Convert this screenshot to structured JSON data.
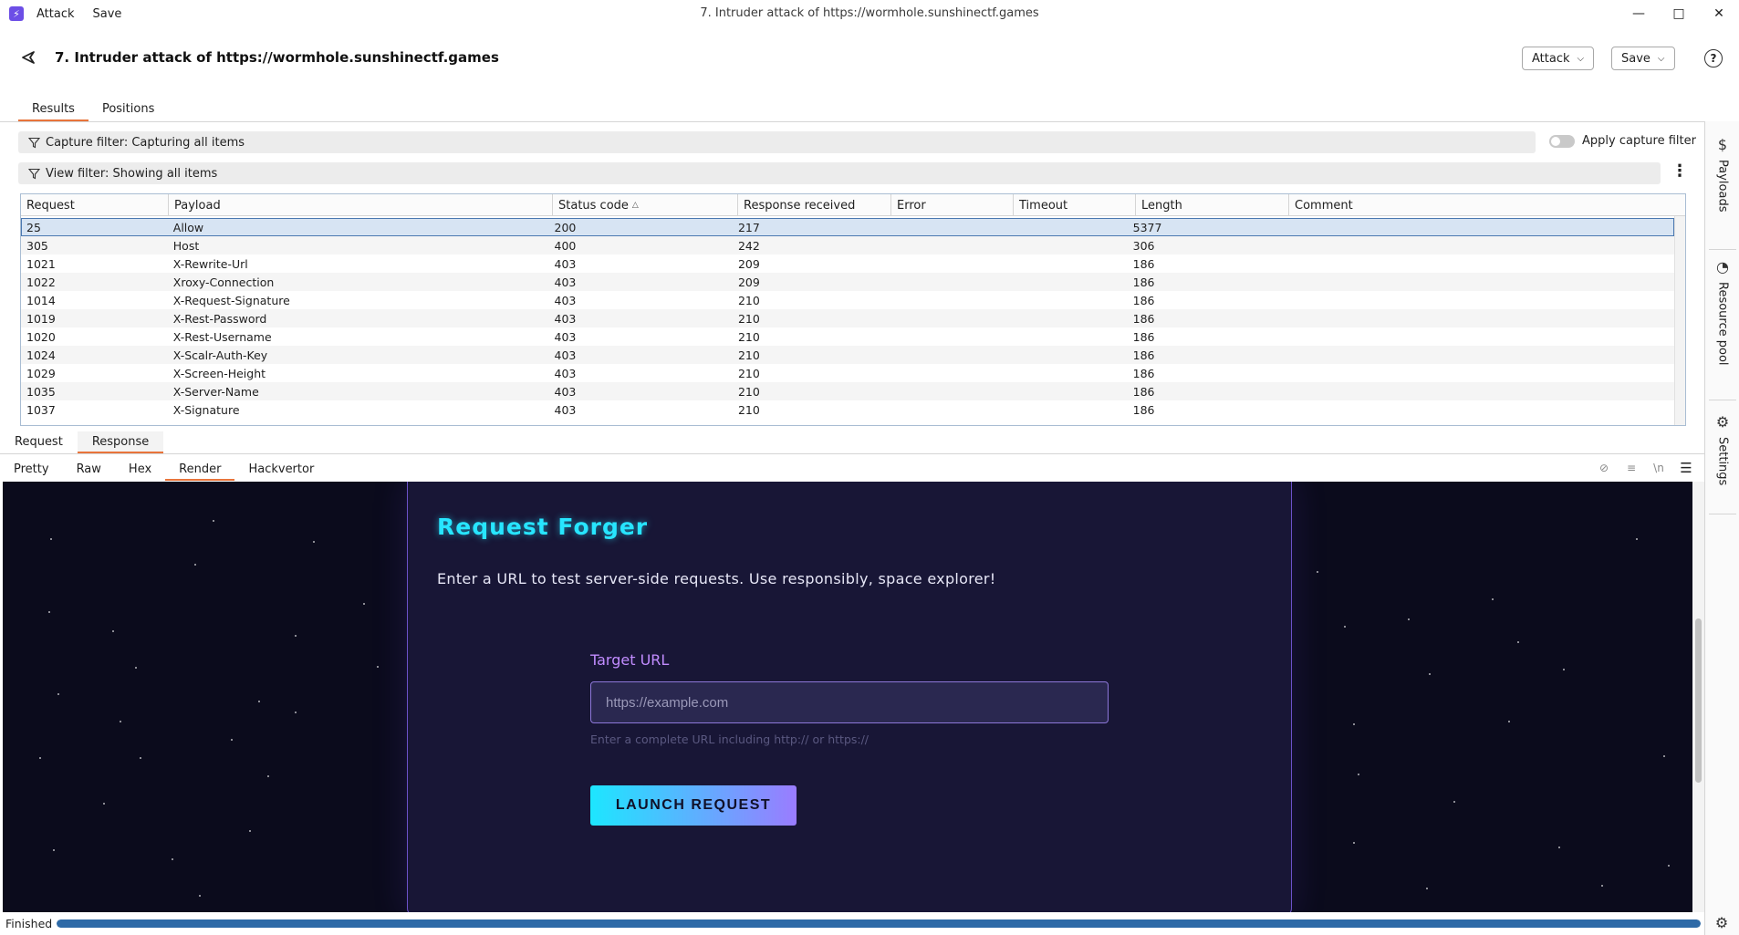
{
  "window": {
    "menu": [
      "Attack",
      "Save"
    ],
    "title": "7. Intruder attack of https://wormhole.sunshinectf.games"
  },
  "header": {
    "title": "7. Intruder attack of https://wormhole.sunshinectf.games",
    "attack_label": "Attack",
    "save_label": "Save"
  },
  "tabs": [
    "Results",
    "Positions"
  ],
  "rail": [
    "Payloads",
    "Resource pool",
    "Settings"
  ],
  "filters": {
    "capture": "Capture filter: Capturing all items",
    "view": "View filter: Showing all items",
    "apply_capture": "Apply capture filter"
  },
  "table": {
    "columns": [
      "Request",
      "Payload",
      "Status code",
      "Response received",
      "Error",
      "Timeout",
      "Length",
      "Comment"
    ],
    "rows": [
      [
        "25",
        "Allow",
        "200",
        "217",
        "",
        "",
        "5377",
        ""
      ],
      [
        "305",
        "Host",
        "400",
        "242",
        "",
        "",
        "306",
        ""
      ],
      [
        "1021",
        "X-Rewrite-Url",
        "403",
        "209",
        "",
        "",
        "186",
        ""
      ],
      [
        "1022",
        "Xroxy-Connection",
        "403",
        "209",
        "",
        "",
        "186",
        ""
      ],
      [
        "1014",
        "X-Request-Signature",
        "403",
        "210",
        "",
        "",
        "186",
        ""
      ],
      [
        "1019",
        "X-Rest-Password",
        "403",
        "210",
        "",
        "",
        "186",
        ""
      ],
      [
        "1020",
        "X-Rest-Username",
        "403",
        "210",
        "",
        "",
        "186",
        ""
      ],
      [
        "1024",
        "X-Scalr-Auth-Key",
        "403",
        "210",
        "",
        "",
        "186",
        ""
      ],
      [
        "1029",
        "X-Screen-Height",
        "403",
        "210",
        "",
        "",
        "186",
        ""
      ],
      [
        "1035",
        "X-Server-Name",
        "403",
        "210",
        "",
        "",
        "186",
        ""
      ],
      [
        "1037",
        "X-Signature",
        "403",
        "210",
        "",
        "",
        "186",
        ""
      ]
    ]
  },
  "rr_tabs": [
    "Request",
    "Response"
  ],
  "view_tabs": [
    "Pretty",
    "Raw",
    "Hex",
    "Render",
    "Hackvertor"
  ],
  "render": {
    "title": "Request Forger",
    "subtitle": "Enter a URL to test server-side requests. Use responsibly, space explorer!",
    "field_label": "Target URL",
    "placeholder": "https://example.com",
    "hint": "Enter a complete URL including http:// or https://",
    "button": "LAUNCH REQUEST"
  },
  "status": {
    "text": "Finished",
    "progress": 1.0
  },
  "colors": {
    "accent_tab": "#e8743b",
    "neon_cyan": "#27e5ff",
    "neon_purple": "#9a7cff",
    "progress": "#2e6aa7"
  }
}
